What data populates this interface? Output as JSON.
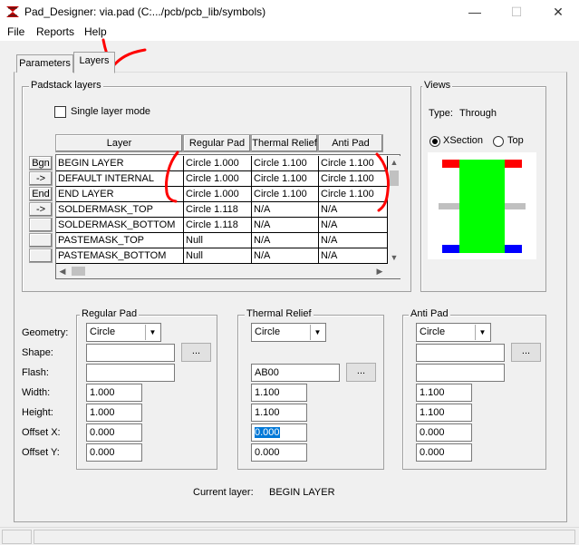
{
  "window": {
    "title": "Pad_Designer: via.pad (C:.../pcb/pcb_lib/symbols)",
    "minimize": "—",
    "maximize": "☐",
    "close": "✕"
  },
  "menu": {
    "file": "File",
    "reports": "Reports",
    "help": "Help"
  },
  "tabs": {
    "parameters": "Parameters",
    "layers": "Layers"
  },
  "padstack": {
    "group_label": "Padstack layers",
    "single_layer_mode": "Single layer mode",
    "single_layer_checked": false,
    "columns": [
      "Layer",
      "Regular Pad",
      "Thermal Relief",
      "Anti Pad"
    ],
    "row_buttons": [
      "Bgn",
      "->",
      "End",
      "->",
      "",
      "",
      ""
    ],
    "rows": [
      [
        "BEGIN LAYER",
        "Circle 1.000",
        "Circle 1.100",
        "Circle 1.100"
      ],
      [
        "DEFAULT INTERNAL",
        "Circle 1.000",
        "Circle 1.100",
        "Circle 1.100"
      ],
      [
        "END LAYER",
        "Circle 1.000",
        "Circle 1.100",
        "Circle 1.100"
      ],
      [
        "SOLDERMASK_TOP",
        "Circle 1.118",
        "N/A",
        "N/A"
      ],
      [
        "SOLDERMASK_BOTTOM",
        "Circle 1.118",
        "N/A",
        "N/A"
      ],
      [
        "PASTEMASK_TOP",
        "Null",
        "N/A",
        "N/A"
      ],
      [
        "PASTEMASK_BOTTOM",
        "Null",
        "N/A",
        "N/A"
      ]
    ]
  },
  "views": {
    "group_label": "Views",
    "type_label": "Type:",
    "type_value": "Through",
    "xsection": "XSection",
    "top": "Top",
    "selected": "XSection",
    "colors": {
      "barrel": "#00ff00",
      "top_pad": "#ff0000",
      "bottom_pad": "#0000ff",
      "internal": "#c0c0c0"
    }
  },
  "regular_pad": {
    "group_label": "Regular Pad",
    "geometry": "Circle",
    "shape": "",
    "flash": "",
    "width": "1.000",
    "height": "1.000",
    "offset_x": "0.000",
    "offset_y": "0.000",
    "browse": "..."
  },
  "thermal_relief": {
    "group_label": "Thermal Relief",
    "geometry": "Circle",
    "flash": "AB00",
    "width": "1.100",
    "height": "1.100",
    "offset_x": "0.000",
    "offset_y": "0.000",
    "browse": "..."
  },
  "anti_pad": {
    "group_label": "Anti Pad",
    "geometry": "Circle",
    "shape": "",
    "flash": "",
    "width": "1.100",
    "height": "1.100",
    "offset_x": "0.000",
    "offset_y": "0.000",
    "browse": "..."
  },
  "field_labels": {
    "geometry": "Geometry:",
    "shape": "Shape:",
    "flash": "Flash:",
    "width": "Width:",
    "height": "Height:",
    "offset_x": "Offset X:",
    "offset_y": "Offset Y:"
  },
  "current_layer": {
    "label": "Current layer:",
    "value": "BEGIN LAYER"
  },
  "annotation_color": "#ff0000"
}
